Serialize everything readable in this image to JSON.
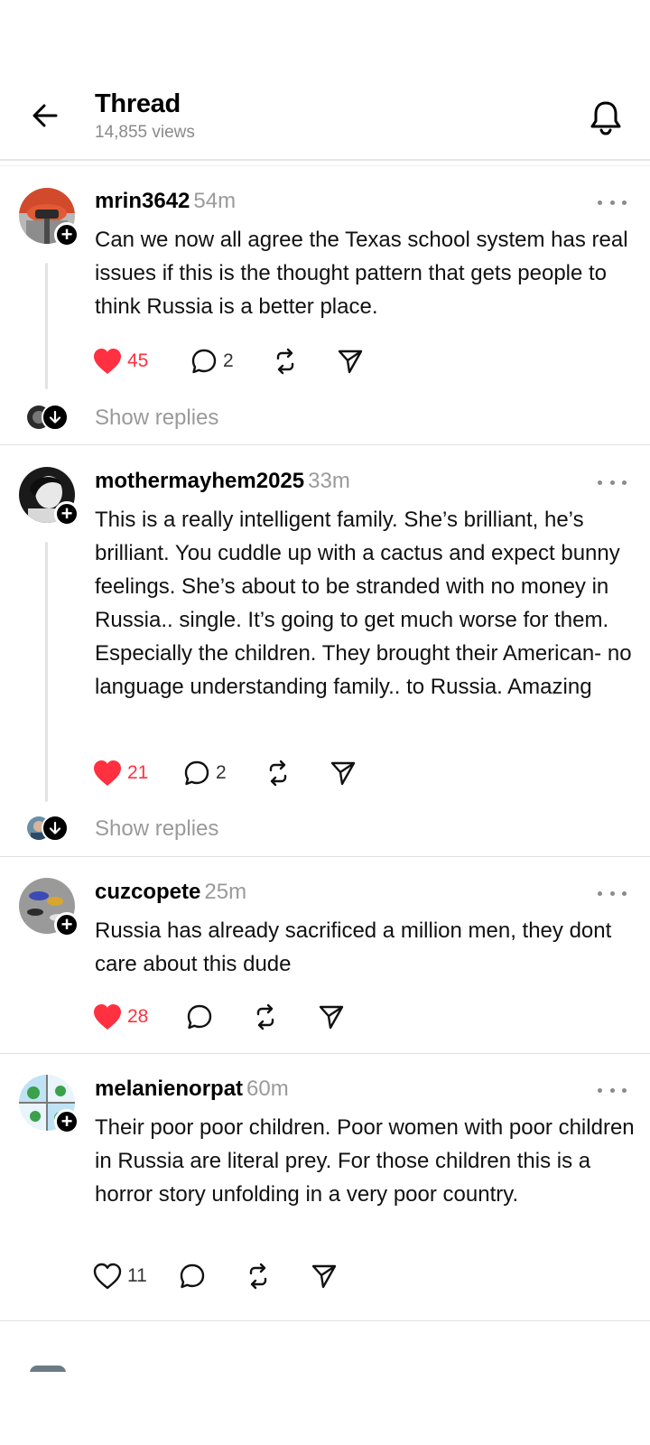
{
  "header": {
    "title": "Thread",
    "views": "14,855 views",
    "back_icon": "arrow-left-icon",
    "bell_icon": "bell-icon"
  },
  "colors": {
    "like": "#ff3040",
    "muted": "#9a9a9a",
    "divider": "#e0e0e0"
  },
  "posts": [
    {
      "username": "mrin3642",
      "time": "54m",
      "text": "Can we now all agree the Texas school system has real issues if this is the thought pattern that gets people to think Russia is a better place.",
      "likes": "45",
      "liked": true,
      "replies": "2",
      "show_replies": "Show replies"
    },
    {
      "username": "mothermayhem2025",
      "time": "33m",
      "text": "This is a really intelligent family. She’s brilliant, he’s brilliant. You cuddle up with a cactus and expect bunny feelings. She’s about to be stranded with no money in Russia.. single. It’s going to get much worse for them. Especially the children. They brought their American- no language understanding family.. to Russia. Amazing",
      "likes": "21",
      "liked": true,
      "replies": "2",
      "show_replies": "Show replies"
    },
    {
      "username": "cuzcopete",
      "time": "25m",
      "text": "Russia has already sacrificed a million men, they dont care about this dude",
      "likes": "28",
      "liked": true,
      "replies": ""
    },
    {
      "username": "melanienorpat",
      "time": "60m",
      "text": "Their poor poor children. Poor women with poor children in Russia are literal prey. For those children this is a horror story unfolding in a very poor country.",
      "likes": "11",
      "liked": false,
      "replies": ""
    }
  ]
}
